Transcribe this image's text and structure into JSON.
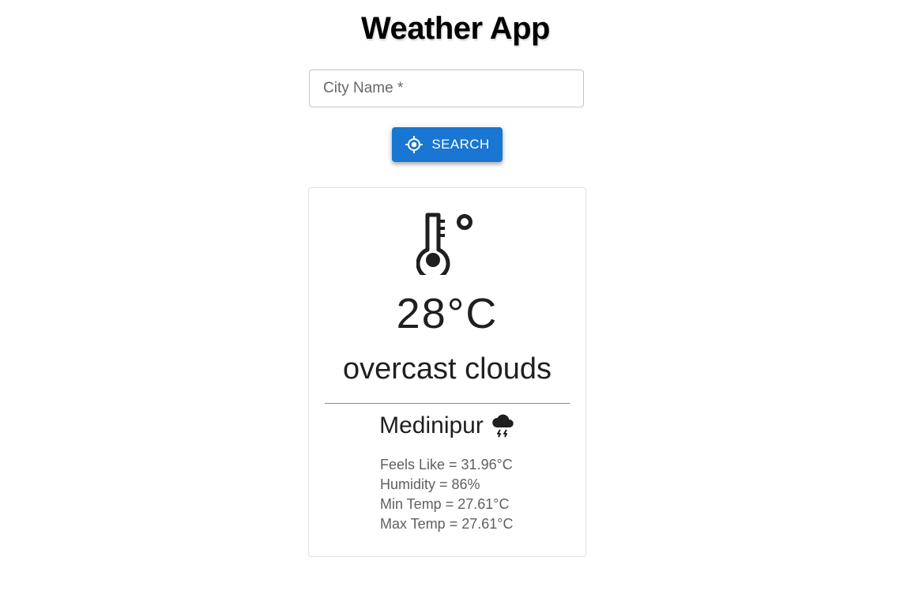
{
  "app": {
    "title": "Weather App"
  },
  "search": {
    "placeholder": "City Name *",
    "value": "",
    "button_label": "SEARCH",
    "button_icon": "my-location-icon"
  },
  "weather": {
    "main_icon": "thermometer-icon",
    "temperature": "28°C",
    "description": "overcast clouds",
    "city": "Medinipur",
    "city_icon": "thunderstorm-icon",
    "details": {
      "feels_like": "Feels Like = 31.96°C",
      "humidity": "Humidity = 86%",
      "min_temp": "Min Temp = 27.61°C",
      "max_temp": "Max Temp = 27.61°C"
    }
  },
  "colors": {
    "primary": "#1976d2",
    "text": "#1f1f1f",
    "secondary_text": "#5f5f5f",
    "border": "#c4c4c4"
  }
}
